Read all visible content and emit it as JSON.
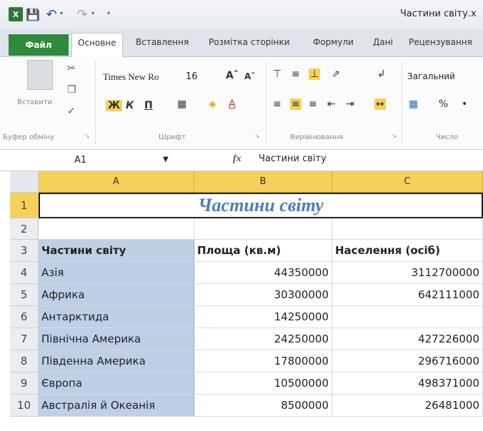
{
  "window": {
    "title": "Частини світу.x"
  },
  "quick_access": {
    "app_icon": "X",
    "save_icon": "save-icon",
    "undo_icon": "undo-icon",
    "redo_icon": "redo-icon"
  },
  "tabs": [
    {
      "label": "Файл"
    },
    {
      "label": "Основне"
    },
    {
      "label": "Вставлення"
    },
    {
      "label": "Розмітка сторінки"
    },
    {
      "label": "Формули"
    },
    {
      "label": "Дані"
    },
    {
      "label": "Рецензування"
    }
  ],
  "ribbon": {
    "clipboard": {
      "paste_label": "Вставити",
      "group_label": "Буфер обміну"
    },
    "font": {
      "family": "Times New Ro",
      "size": "16",
      "bold": "Ж",
      "italic": "К",
      "underline": "П",
      "group_label": "Шрифт"
    },
    "alignment": {
      "group_label": "Вирівнювання"
    },
    "number": {
      "format": "Загальний",
      "percent": "%",
      "group_label": "Число"
    }
  },
  "formula_bar": {
    "name_box": "A1",
    "fx_label": "fx",
    "value": "Частини світу"
  },
  "grid": {
    "columns": [
      "A",
      "B",
      "C"
    ],
    "title": "Частини світу",
    "rows": [
      "1",
      "2",
      "3",
      "4",
      "5",
      "6",
      "7",
      "8",
      "9",
      "10"
    ],
    "headers": [
      "Частини світу",
      "Площа (кв.м)",
      "Населення (осіб)"
    ],
    "data": [
      {
        "name": "Азія",
        "area": "44350000",
        "population": "3112700000"
      },
      {
        "name": "Африка",
        "area": "30300000",
        "population": "642111000"
      },
      {
        "name": "Антарктида",
        "area": "14250000",
        "population": ""
      },
      {
        "name": "Північна Америка",
        "area": "24250000",
        "population": "427226000"
      },
      {
        "name": "Південна Америка",
        "area": "17800000",
        "population": "296716000"
      },
      {
        "name": "Європа",
        "area": "10500000",
        "population": "498371000"
      },
      {
        "name": "Австралія й Океанія",
        "area": "8500000",
        "population": "26481000"
      }
    ]
  },
  "colors": {
    "accent_green": "#2f8a3c",
    "header_yellow": "#f5d15a",
    "name_col": "#bfd0e6",
    "title_blue": "#4e7cc0"
  }
}
